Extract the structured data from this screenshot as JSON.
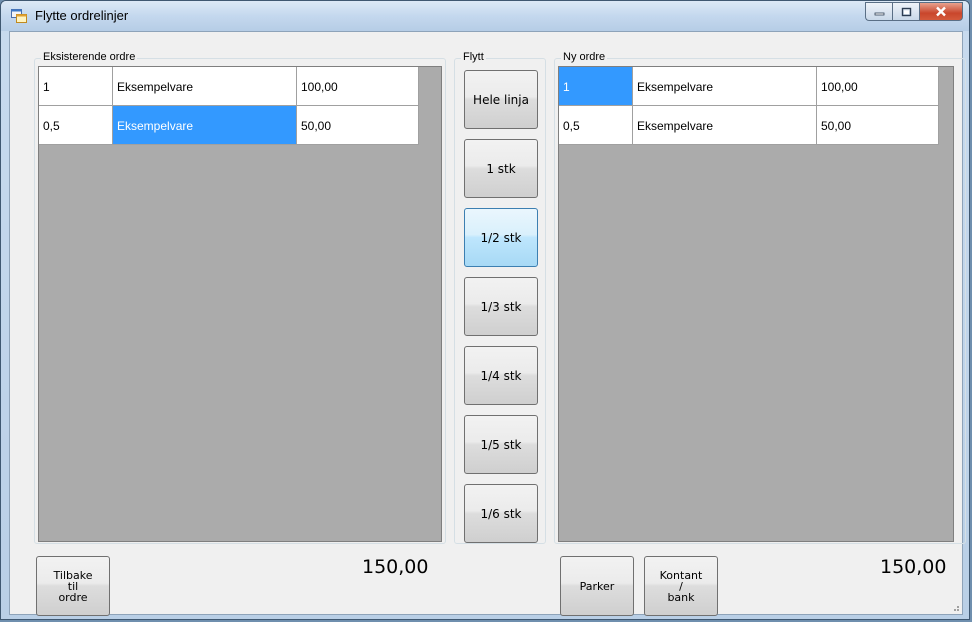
{
  "window": {
    "title": "Flytte ordrelinjer",
    "icon": "app-form-icon"
  },
  "existing": {
    "group_label": "Eksisterende ordre",
    "rows": [
      {
        "qty": "1",
        "item": "Eksempelvare",
        "amount": "100,00"
      },
      {
        "qty": "0,5",
        "item": "Eksempelvare",
        "amount": "50,00"
      }
    ],
    "total": "150,00",
    "back_button": "Tilbake\ntil\nordre"
  },
  "move": {
    "group_label": "Flytt",
    "buttons": [
      "Hele linja",
      "1 stk",
      "1/2 stk",
      "1/3 stk",
      "1/4 stk",
      "1/5 stk",
      "1/6 stk"
    ],
    "active_index": 2
  },
  "new": {
    "group_label": "Ny ordre",
    "rows": [
      {
        "qty": "1",
        "item": "Eksempelvare",
        "amount": "100,00"
      },
      {
        "qty": "0,5",
        "item": "Eksempelvare",
        "amount": "50,00"
      }
    ],
    "total": "150,00",
    "park_button": "Parker",
    "pay_button": "Kontant\n/\nbank"
  },
  "colors": {
    "selection": "#3399ff",
    "grid_bg": "#ababab",
    "window_bg": "#f0f0f0"
  }
}
